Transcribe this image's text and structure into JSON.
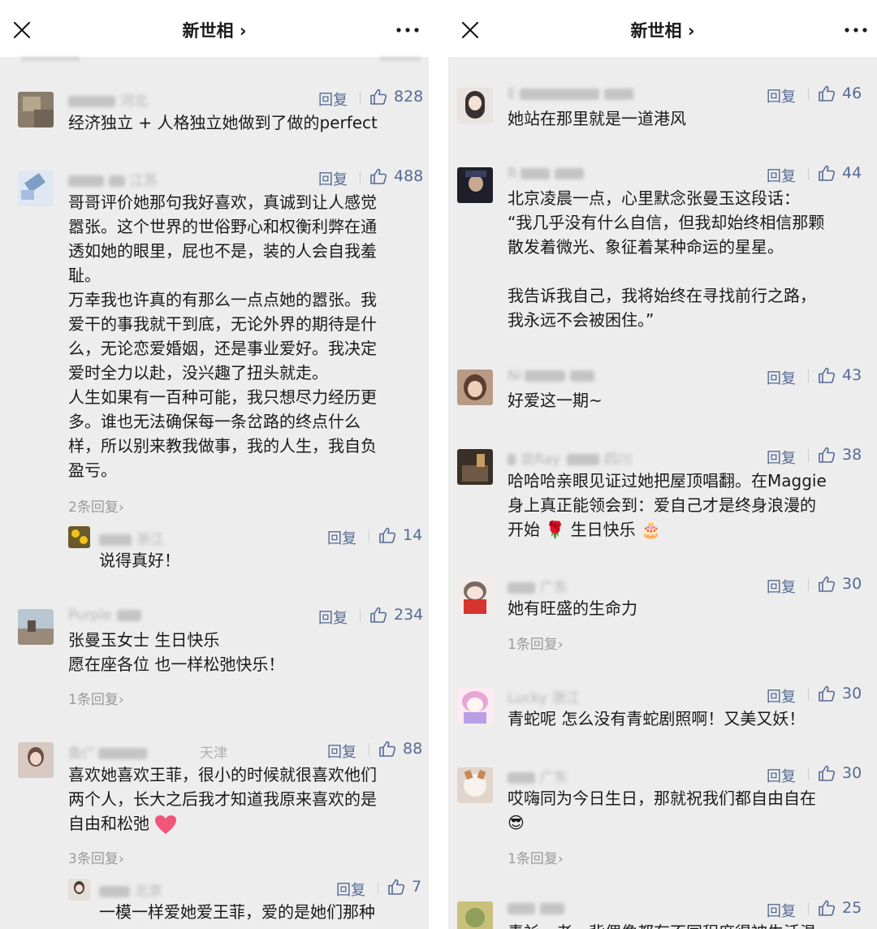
{
  "header": {
    "title": "新世相 ›",
    "close_icon": "close-icon",
    "more_icon": "more-dots-icon"
  },
  "left": {
    "comments": [
      {
        "user": "贝振民",
        "location": "河北",
        "reply_label": "回复",
        "likes": "828",
        "lines": [
          "经济独立 + 人格独立她做到了做的perfect"
        ]
      },
      {
        "user": "",
        "location": "江苏",
        "reply_label": "回复",
        "likes": "488",
        "lines": [
          "哥哥评价她那句我好喜欢，真诚到让人感觉",
          "嚣张。这个世界的世俗野心和权衡利弊在通",
          "透如她的眼里，屁也不是，装的人会自我羞",
          "耻。",
          "万幸我也许真的有那么一点点她的嚣张。我",
          "爱干的事我就干到底，无论外界的期待是什",
          "么，无论恋爱婚姻，还是事业爱好。我决定",
          "爱时全力以赴，没兴趣了扭头就走。",
          "人生如果有一百种可能，我只想尽力经历更",
          "多。谁也无法确保每一条岔路的终点什么",
          "样，所以别来教我做事，我的人生，我自负",
          "盈亏。"
        ],
        "more_replies": "2条回复›",
        "sub_reply": {
          "user": "曼迟",
          "location": "浙江",
          "reply_label": "回复",
          "likes": "14",
          "text": "说得真好！"
        }
      },
      {
        "user": "Purple",
        "location": "",
        "reply_label": "回复",
        "likes": "234",
        "lines": [
          "张曼玉女士 生日快乐",
          "愿在座各位 也一样松弛快乐！"
        ],
        "more_replies": "1条回复›"
      },
      {
        "user": "鱼(\"",
        "location": "天津",
        "reply_label": "回复",
        "likes": "88",
        "lines": [
          "喜欢她喜欢王菲，很小的时候就很喜欢他们",
          "两个人，长大之后我才知道我原来喜欢的是",
          "自由和松弛"
        ],
        "more_replies": "3条回复›",
        "sub_reply": {
          "user": "",
          "location": "北京",
          "reply_label": "回复",
          "likes": "7",
          "text": "一模一样爱她爱王菲，爱的是她们那种"
        }
      }
    ]
  },
  "right": {
    "comments": [
      {
        "user": "E",
        "location": "",
        "reply_label": "回复",
        "likes": "46",
        "lines": [
          "她站在那里就是一道港风"
        ]
      },
      {
        "user": "R",
        "location": "",
        "reply_label": "回复",
        "likes": "44",
        "lines": [
          "北京凌晨一点，心里默念张曼玉这段话：",
          "“我几乎没有什么自信，但我却始终相信那颗",
          "散发着微光、象征着某种命运的星星。",
          "",
          "我告诉我自己，我将始终在寻找前行之路，",
          "我永远不会被困住。”"
        ]
      },
      {
        "user": "Ni",
        "location": "",
        "reply_label": "回复",
        "likes": "43",
        "lines": [
          "好爱这一期~"
        ]
      },
      {
        "user": "说Ray",
        "location": "四川",
        "reply_label": "回复",
        "likes": "38",
        "lines": [
          "哈哈哈亲眼见证过她把屋顶唱翻。在Maggie",
          "身上真正能领会到：爱自己才是终身浪漫的",
          "开始 🌹 生日快乐 🎂"
        ]
      },
      {
        "user": "",
        "location": "广东",
        "reply_label": "回复",
        "likes": "30",
        "lines": [
          "她有旺盛的生命力"
        ],
        "more_replies": "1条回复›"
      },
      {
        "user": "Lucky",
        "location": "浙江",
        "reply_label": "回复",
        "likes": "30",
        "lines": [
          "青蛇呢 怎么没有青蛇剧照啊！又美又妖！"
        ]
      },
      {
        "user": "",
        "location": "广东",
        "reply_label": "回复",
        "likes": "30",
        "lines": [
          "哎嗨同为今日生日，那就祝我们都自由自在",
          "😎"
        ],
        "more_replies": "1条回复›"
      },
      {
        "user": "",
        "location": "",
        "reply_label": "回复",
        "likes": "25",
        "lines": [
          "青衫一老，背俚像都有不同程度得被生活温"
        ]
      }
    ]
  }
}
